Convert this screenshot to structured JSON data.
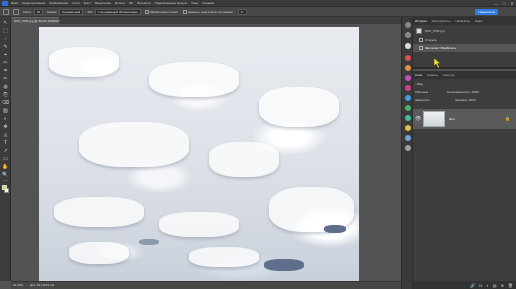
{
  "menu": {
    "items": [
      "Файл",
      "Редактирование",
      "Изображение",
      "Слои",
      "Текст",
      "Выделение",
      "Фильтр",
      "3D",
      "Просмотр",
      "Подключаемые модули",
      "Окно",
      "Справка"
    ],
    "window_controls": [
      "—",
      "□",
      "✕"
    ]
  },
  "options": {
    "size_label": "Кисть:",
    "size_value": "30",
    "mode_label": "Режим:",
    "mode_value": "Нормальный",
    "diffusion_label": "Тип:",
    "diffusion_value": "Учитывающий 3D имитацию",
    "sample_all_label": "Образец всех слоев",
    "pressure_label": "Нажатие пера влияет на размер",
    "angle_value": "0°",
    "share_label": "Поделиться"
  },
  "document": {
    "tab_title": "DSC_6761.jpg @ 33,3% (RGB/8) *",
    "status_zoom": "33,33%",
    "status_doc": "Док: 39,1M/39,1M"
  },
  "tools": [
    "↖",
    "⬚",
    "◌",
    "✎",
    "⌖",
    "✂",
    "⌗",
    "✏",
    "◍",
    "⎘",
    "⌫",
    "▧",
    "◐",
    "✥",
    "◬",
    "T",
    "↗",
    "▭",
    "✋",
    "🔍",
    "⋯"
  ],
  "history_panel": {
    "tabs": [
      "История",
      "Инструменты",
      "Навигатор",
      "Инфо"
    ],
    "snapshot": "DSC_6761.jpg",
    "rows": [
      "Открыть",
      "Заплатка: Обработать"
    ]
  },
  "layers_panel": {
    "tabs": [
      "Слои",
      "Каналы",
      "Контуры"
    ],
    "search_label": "Вид",
    "blend_mode": "Обычные",
    "opacity_label": "Непрозрачность:",
    "opacity_value": "100%",
    "lock_label": "Закрепить:",
    "fill_label": "Заливка:",
    "fill_value": "100%",
    "layer_name": "Фон",
    "footer_icons": [
      "🔗",
      "fx",
      "◐",
      "▤",
      "⊕",
      "🗑"
    ]
  },
  "colors": {
    "foreground": "#e3d640",
    "background": "#ffffff",
    "accent": "#2f7ce0"
  }
}
